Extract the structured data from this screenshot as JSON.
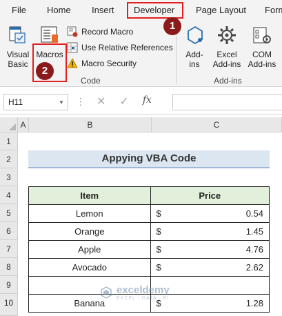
{
  "ribbon_tabs": [
    "File",
    "Home",
    "Insert",
    "Developer",
    "Page Layout",
    "Form"
  ],
  "ribbon": {
    "visual_basic_line1": "Visual",
    "visual_basic_line2": "Basic",
    "macros_label": "Macros",
    "record_macro": "Record Macro",
    "use_relative_references": "Use Relative References",
    "macro_security": "Macro Security",
    "code_group": "Code",
    "addins_line1": "Add-",
    "addins_line2": "ins",
    "excel_addins_line1": "Excel",
    "excel_addins_line2": "Add-ins",
    "com_addins_line1": "COM",
    "com_addins_line2": "Add-ins",
    "addins_group": "Add-ins"
  },
  "badges": {
    "step1": "1",
    "step2": "2"
  },
  "formula_bar": {
    "name_box": "H11",
    "fx": "fx",
    "cancel": "✕",
    "enter": "✓",
    "separator": "⋮"
  },
  "columns": [
    "A",
    "B",
    "C"
  ],
  "rows": [
    "1",
    "2",
    "3",
    "4",
    "5",
    "6",
    "7",
    "8",
    "9",
    "10"
  ],
  "title": "Appying VBA Code",
  "table": {
    "headers": [
      "Item",
      "Price"
    ],
    "rows": [
      {
        "item": "Lemon",
        "currency": "$",
        "price": "0.54"
      },
      {
        "item": "Orange",
        "currency": "$",
        "price": "1.45"
      },
      {
        "item": "Apple",
        "currency": "$",
        "price": "4.76"
      },
      {
        "item": "Avocado",
        "currency": "$",
        "price": "2.62"
      },
      {
        "item": "",
        "currency": "",
        "price": ""
      },
      {
        "item": "Banana",
        "currency": "$",
        "price": "1.28"
      }
    ]
  },
  "watermark": {
    "name": "exceldemy",
    "tagline": "EXCEL · DATA · BI"
  },
  "colors": {
    "badge": "#8b1a1a",
    "highlight": "#e02020",
    "title_fill": "#dce6f1",
    "header_fill": "#e2efda"
  }
}
